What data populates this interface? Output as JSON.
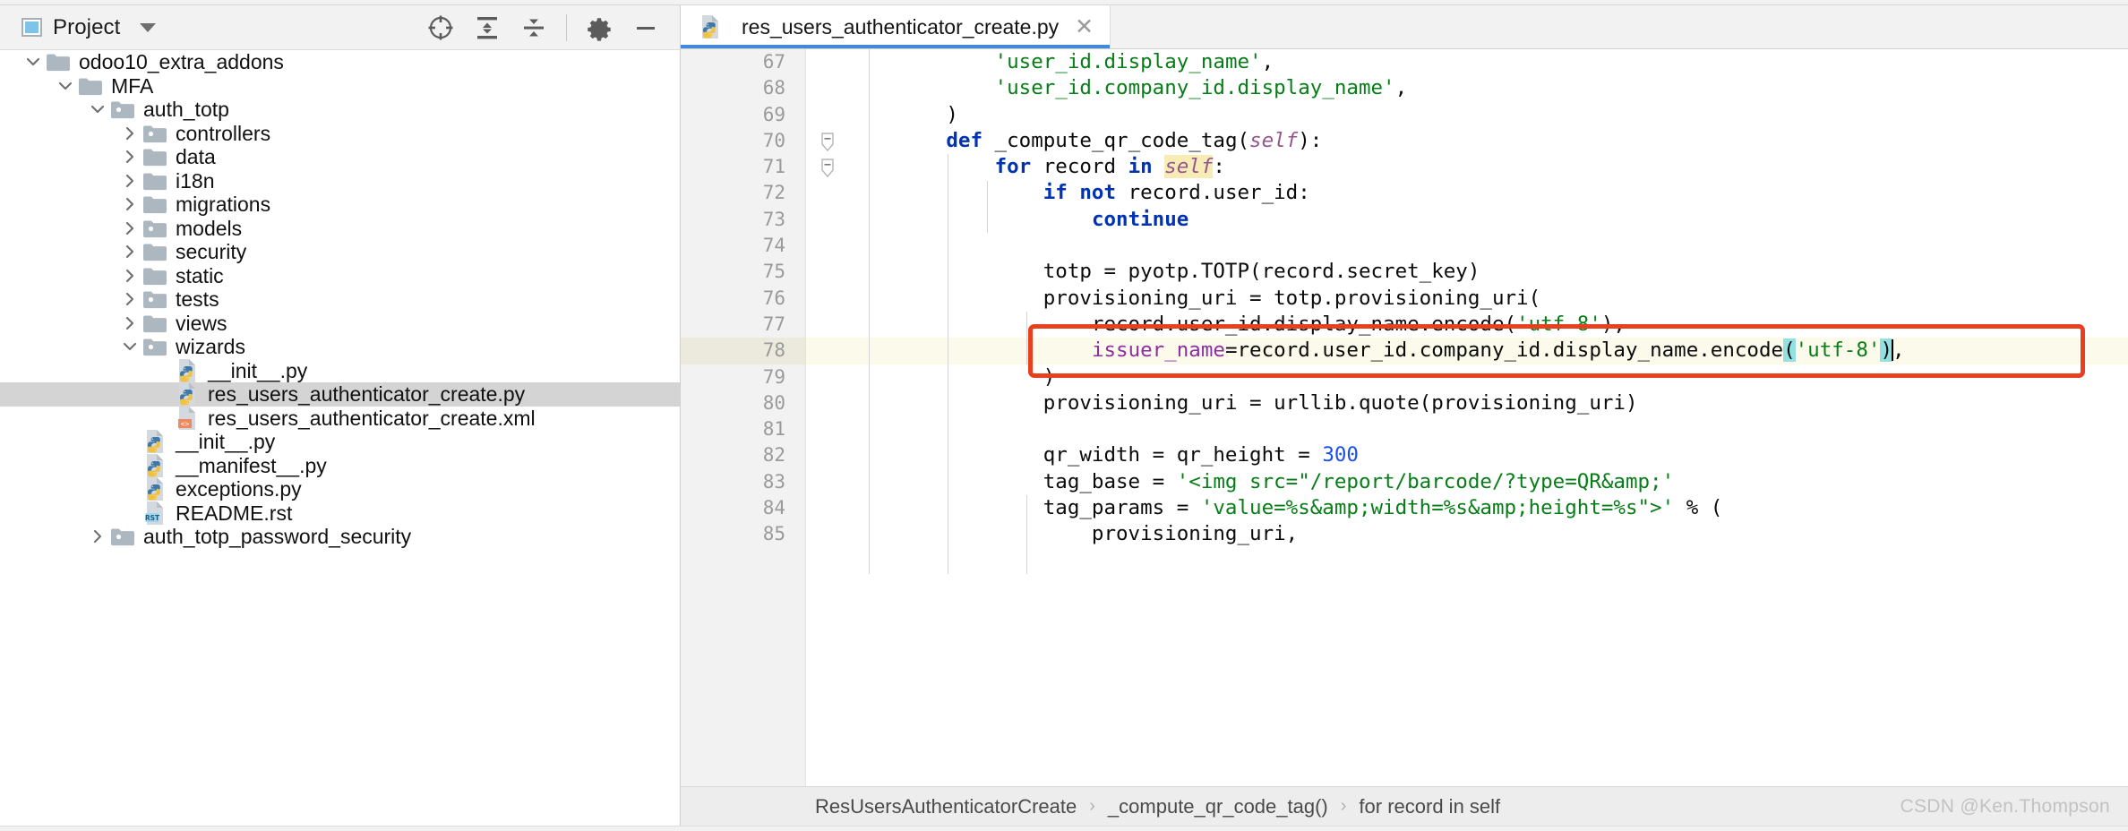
{
  "project_panel": {
    "title": "Project",
    "window_icon": "project-window-icon",
    "dropdown_icon": "chevron-down-icon",
    "tools": [
      {
        "name": "locate-icon",
        "label": "Select Opened File"
      },
      {
        "name": "expand-all-icon",
        "label": "Expand All"
      },
      {
        "name": "collapse-all-icon",
        "label": "Collapse All"
      },
      {
        "name": "gear-icon",
        "label": "Settings"
      },
      {
        "name": "minimize-icon",
        "label": "Hide"
      }
    ],
    "tree": [
      {
        "label": "odoo10_extra_addons",
        "depth": 0,
        "type": "folder",
        "state": "expanded",
        "selected": false
      },
      {
        "label": "MFA",
        "depth": 1,
        "type": "folder",
        "state": "expanded",
        "selected": false
      },
      {
        "label": "auth_totp",
        "depth": 2,
        "type": "module",
        "state": "expanded",
        "selected": false
      },
      {
        "label": "controllers",
        "depth": 3,
        "type": "module",
        "state": "collapsed",
        "selected": false
      },
      {
        "label": "data",
        "depth": 3,
        "type": "folder",
        "state": "collapsed",
        "selected": false
      },
      {
        "label": "i18n",
        "depth": 3,
        "type": "folder",
        "state": "collapsed",
        "selected": false
      },
      {
        "label": "migrations",
        "depth": 3,
        "type": "folder",
        "state": "collapsed",
        "selected": false
      },
      {
        "label": "models",
        "depth": 3,
        "type": "module",
        "state": "collapsed",
        "selected": false
      },
      {
        "label": "security",
        "depth": 3,
        "type": "folder",
        "state": "collapsed",
        "selected": false
      },
      {
        "label": "static",
        "depth": 3,
        "type": "folder",
        "state": "collapsed",
        "selected": false
      },
      {
        "label": "tests",
        "depth": 3,
        "type": "module",
        "state": "collapsed",
        "selected": false
      },
      {
        "label": "views",
        "depth": 3,
        "type": "folder",
        "state": "collapsed",
        "selected": false
      },
      {
        "label": "wizards",
        "depth": 3,
        "type": "module",
        "state": "expanded",
        "selected": false
      },
      {
        "label": "__init__.py",
        "depth": 4,
        "type": "python",
        "state": "leaf",
        "selected": false
      },
      {
        "label": "res_users_authenticator_create.py",
        "depth": 4,
        "type": "python",
        "state": "leaf",
        "selected": true
      },
      {
        "label": "res_users_authenticator_create.xml",
        "depth": 4,
        "type": "xml",
        "state": "leaf",
        "selected": false
      },
      {
        "label": "__init__.py",
        "depth": 3,
        "type": "python",
        "state": "leaf",
        "selected": false
      },
      {
        "label": "__manifest__.py",
        "depth": 3,
        "type": "python",
        "state": "leaf",
        "selected": false
      },
      {
        "label": "exceptions.py",
        "depth": 3,
        "type": "python",
        "state": "leaf",
        "selected": false
      },
      {
        "label": "README.rst",
        "depth": 3,
        "type": "rst",
        "state": "leaf",
        "selected": false
      },
      {
        "label": "auth_totp_password_security",
        "depth": 2,
        "type": "module",
        "state": "collapsed",
        "selected": false
      }
    ]
  },
  "editor": {
    "tab": {
      "label": "res_users_authenticator_create.py",
      "icon": "python-file-icon",
      "close_icon": "close-icon",
      "active": true
    },
    "first_line_number": 67,
    "highlighted_line_number": 78,
    "lines": [
      {
        "n": 67,
        "text": "            'user_id.display_name',"
      },
      {
        "n": 68,
        "text": "            'user_id.company_id.display_name',"
      },
      {
        "n": 69,
        "text": "        )"
      },
      {
        "n": 70,
        "text": "        def _compute_qr_code_tag(self):"
      },
      {
        "n": 71,
        "text": "            for record in self:"
      },
      {
        "n": 72,
        "text": "                if not record.user_id:"
      },
      {
        "n": 73,
        "text": "                    continue"
      },
      {
        "n": 74,
        "text": ""
      },
      {
        "n": 75,
        "text": "                totp = pyotp.TOTP(record.secret_key)"
      },
      {
        "n": 76,
        "text": "                provisioning_uri = totp.provisioning_uri("
      },
      {
        "n": 77,
        "text": "                    record.user_id.display_name.encode('utf-8'),"
      },
      {
        "n": 78,
        "text": "                    issuer_name=record.user_id.company_id.display_name.encode('utf-8'),"
      },
      {
        "n": 79,
        "text": "                )"
      },
      {
        "n": 80,
        "text": "                provisioning_uri = urllib.quote(provisioning_uri)"
      },
      {
        "n": 81,
        "text": ""
      },
      {
        "n": 82,
        "text": "                qr_width = qr_height = 300"
      },
      {
        "n": 83,
        "text": "                tag_base = '<img src=\"/report/barcode/?type=QR&amp;'"
      },
      {
        "n": 84,
        "text": "                tag_params = 'value=%s&amp;width=%s&amp;height=%s\">' % ("
      },
      {
        "n": 85,
        "text": "                    provisioning_uri,"
      }
    ],
    "colors": {
      "keyword": "#0033b3",
      "string": "#067d17",
      "number": "#1750eb",
      "self": "#94558d",
      "param": "#8c2fa3",
      "bracket_match": "#93e0e3",
      "line_highlight": "#fcfaeb",
      "annotation_box": "#e8401f",
      "tab_underline": "#4389d9",
      "selection": "#d4d4d4"
    }
  },
  "breadcrumb": {
    "items": [
      "ResUsersAuthenticatorCreate",
      "_compute_qr_code_tag()",
      "for record in self"
    ],
    "separator": "›"
  },
  "watermark": "CSDN @Ken.Thompson"
}
